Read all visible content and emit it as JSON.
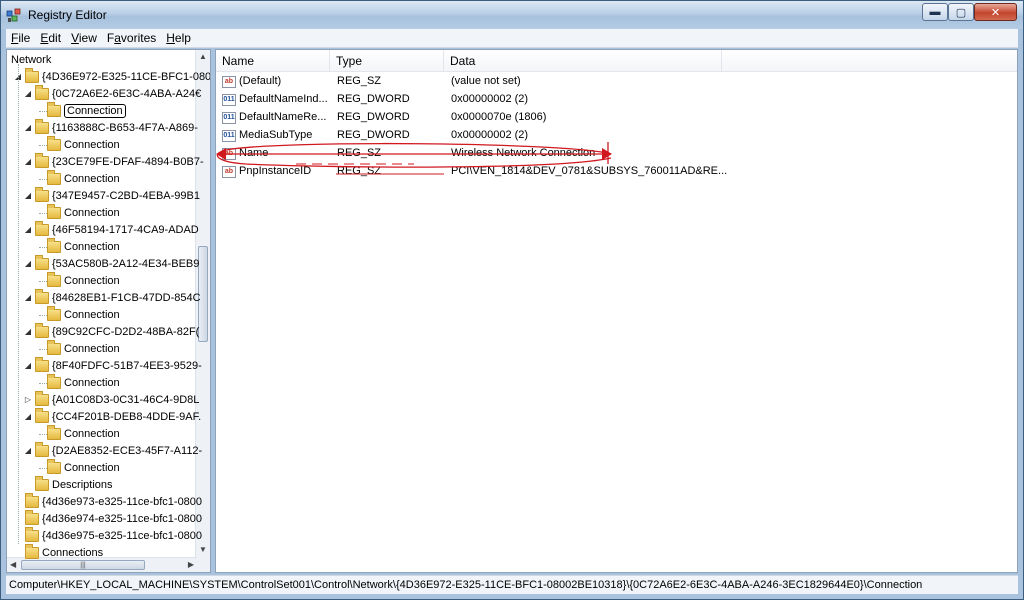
{
  "window": {
    "title": "Registry Editor"
  },
  "menu": [
    {
      "label": "File",
      "accel": "F",
      "rest": "ile"
    },
    {
      "label": "Edit",
      "accel": "E",
      "rest": "dit"
    },
    {
      "label": "View",
      "accel": "V",
      "rest": "iew"
    },
    {
      "label": "Favorites",
      "accel": "a",
      "pre": "F",
      "rest": "vorites"
    },
    {
      "label": "Help",
      "accel": "H",
      "rest": "elp"
    }
  ],
  "tree": {
    "root": "Network",
    "items": [
      {
        "label": "{4D36E972-E325-11CE-BFC1-080",
        "level": 1,
        "expander": "◢",
        "type": "folder"
      },
      {
        "label": "{0C72A6E2-6E3C-4ABA-A24€",
        "level": 2,
        "expander": "◢",
        "type": "folder"
      },
      {
        "label": "Connection",
        "level": 3,
        "expander": "",
        "type": "folder",
        "selected": true
      },
      {
        "label": "{1163888C-B653-4F7A-A869-",
        "level": 2,
        "expander": "◢",
        "type": "folder"
      },
      {
        "label": "Connection",
        "level": 3,
        "expander": "",
        "type": "folder"
      },
      {
        "label": "{23CE79FE-DFAF-4894-B0B7-",
        "level": 2,
        "expander": "◢",
        "type": "folder"
      },
      {
        "label": "Connection",
        "level": 3,
        "expander": "",
        "type": "folder"
      },
      {
        "label": "{347E9457-C2BD-4EBA-99B1",
        "level": 2,
        "expander": "◢",
        "type": "folder"
      },
      {
        "label": "Connection",
        "level": 3,
        "expander": "",
        "type": "folder"
      },
      {
        "label": "{46F58194-1717-4CA9-ADAD",
        "level": 2,
        "expander": "◢",
        "type": "folder"
      },
      {
        "label": "Connection",
        "level": 3,
        "expander": "",
        "type": "folder"
      },
      {
        "label": "{53AC580B-2A12-4E34-BEB9",
        "level": 2,
        "expander": "◢",
        "type": "folder"
      },
      {
        "label": "Connection",
        "level": 3,
        "expander": "",
        "type": "folder"
      },
      {
        "label": "{84628EB1-F1CB-47DD-854C",
        "level": 2,
        "expander": "◢",
        "type": "folder"
      },
      {
        "label": "Connection",
        "level": 3,
        "expander": "",
        "type": "folder"
      },
      {
        "label": "{89C92CFC-D2D2-48BA-82F(",
        "level": 2,
        "expander": "◢",
        "type": "folder"
      },
      {
        "label": "Connection",
        "level": 3,
        "expander": "",
        "type": "folder"
      },
      {
        "label": "{8F40FDFC-51B7-4EE3-9529-",
        "level": 2,
        "expander": "◢",
        "type": "folder"
      },
      {
        "label": "Connection",
        "level": 3,
        "expander": "",
        "type": "folder"
      },
      {
        "label": "{A01C08D3-0C31-46C4-9D8L",
        "level": 2,
        "expander": "▷",
        "type": "folder"
      },
      {
        "label": "{CC4F201B-DEB8-4DDE-9AF.",
        "level": 2,
        "expander": "◢",
        "type": "folder"
      },
      {
        "label": "Connection",
        "level": 3,
        "expander": "",
        "type": "folder"
      },
      {
        "label": "{D2AE8352-ECE3-45F7-A112-",
        "level": 2,
        "expander": "◢",
        "type": "folder"
      },
      {
        "label": "Connection",
        "level": 3,
        "expander": "",
        "type": "folder"
      },
      {
        "label": "Descriptions",
        "level": 2,
        "expander": "",
        "type": "folder"
      },
      {
        "label": "{4d36e973-e325-11ce-bfc1-0800",
        "level": 1,
        "expander": "",
        "type": "folder"
      },
      {
        "label": "{4d36e974-e325-11ce-bfc1-0800",
        "level": 1,
        "expander": "",
        "type": "folder"
      },
      {
        "label": "{4d36e975-e325-11ce-bfc1-0800",
        "level": 1,
        "expander": "",
        "type": "folder"
      },
      {
        "label": "Connections",
        "level": 1,
        "expander": "",
        "type": "folder"
      }
    ]
  },
  "values": {
    "columns": [
      "Name",
      "Type",
      "Data"
    ],
    "rows": [
      {
        "icon": "ab",
        "kind": "sz",
        "name": "(Default)",
        "type": "REG_SZ",
        "data": "(value not set)"
      },
      {
        "icon": "011",
        "kind": "dword",
        "name": "DefaultNameInd...",
        "type": "REG_DWORD",
        "data": "0x00000002 (2)"
      },
      {
        "icon": "011",
        "kind": "dword",
        "name": "DefaultNameRe...",
        "type": "REG_DWORD",
        "data": "0x0000070e (1806)"
      },
      {
        "icon": "011",
        "kind": "dword",
        "name": "MediaSubType",
        "type": "REG_DWORD",
        "data": "0x00000002 (2)"
      },
      {
        "icon": "ab",
        "kind": "sz",
        "name": "Name",
        "type": "REG_SZ",
        "data": "Wireless Network Connection"
      },
      {
        "icon": "ab",
        "kind": "sz",
        "name": "PnpInstanceID",
        "type": "REG_SZ",
        "data": "PCI\\VEN_1814&DEV_0781&SUBSYS_760011AD&RE..."
      }
    ]
  },
  "status": {
    "path": "Computer\\HKEY_LOCAL_MACHINE\\SYSTEM\\ControlSet001\\Control\\Network\\{4D36E972-E325-11CE-BFC1-08002BE10318}\\{0C72A6E2-6E3C-4ABA-A246-3EC1829644E0}\\Connection"
  },
  "colors": {
    "annotation": "#d0181f",
    "titlebar": "#b9cfe6"
  }
}
